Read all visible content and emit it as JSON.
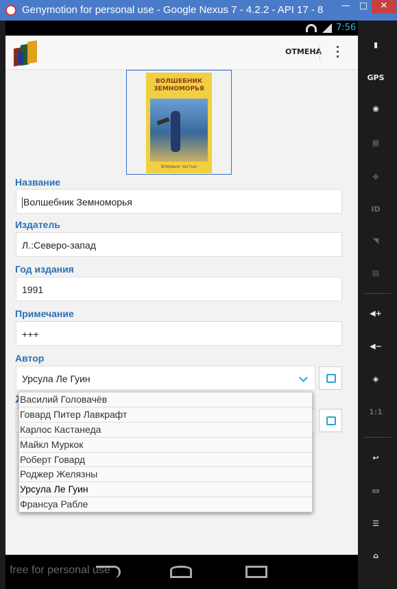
{
  "window": {
    "title": "Genymotion for personal use - Google Nexus 7 - 4.2.2 - API 17 - 8...",
    "minimize": "—",
    "maximize": "□",
    "close": "✕"
  },
  "statusbar": {
    "time": "7:56"
  },
  "actionbar": {
    "cancel_label": "ОТМЕНА"
  },
  "cover": {
    "title": "ВОЛШЕБНИК ЗЕМНОМОРЬЯ",
    "subtitle": "Впервые частью"
  },
  "form": {
    "name_label": "Название",
    "name_value": "Волшебник Земноморья",
    "publisher_label": "Издатель",
    "publisher_value": "Л.:Северо-запад",
    "year_label": "Год  издания",
    "year_value": "1991",
    "note_label": "Примечание",
    "note_value": "+++",
    "author_label": "Автор",
    "author_value": "Урсула Ле Гуин",
    "genre_label_partial": "Ж"
  },
  "dropdown": {
    "items": [
      "Василий Головачёв",
      "Говард Питер Лавкрафт",
      "Карлос Кастанеда",
      "Майкл Муркок",
      "Роберт Говард",
      "Роджер Желязны",
      "Урсула Ле Гуин",
      "Франсуа Рабле"
    ],
    "selected_index": 6
  },
  "navbar": {
    "watermark": "free for personal use"
  },
  "sidebar": {
    "gps": "GPS",
    "id": "ID",
    "zoom": "1:1"
  },
  "colors": {
    "accent": "#2a6fb5",
    "holo_blue": "#33b5e5",
    "titlebar": "#4a7bc9"
  }
}
